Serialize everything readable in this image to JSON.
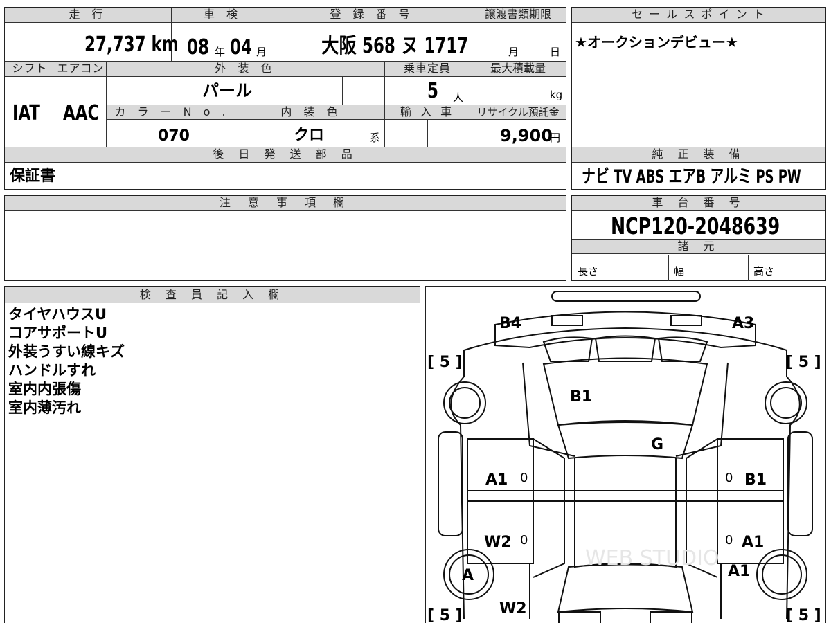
{
  "headers": {
    "mileage": "走 行",
    "inspection": "車 検",
    "registration": "登 録 番 号",
    "transfer_deadline": "譲渡書類期限",
    "sales_point": "セ ー ル ス ポ イ ン ト",
    "shift": "シフト",
    "aircon": "エアコン",
    "exterior_color": "外 装 色",
    "capacity": "乗車定員",
    "max_load": "最大積載量",
    "color_no": "カ ラ ー N o .",
    "interior_color": "内 装 色",
    "import": "輸 入 車",
    "recycle": "リサイクル預託金",
    "shipping_parts": "後 日 発 送 部 品",
    "equipment": "純 正 装 備",
    "notes": "注 意 事 項 欄",
    "chassis": "車 台 番 号",
    "specs": "諸 元",
    "inspector": "検 査 員 記 入 欄"
  },
  "values": {
    "mileage": "27,737 km",
    "inspection_year": "08",
    "inspection_year_unit": "年",
    "inspection_month": "04",
    "inspection_month_unit": "月",
    "registration": "大阪 568 ヌ 1717",
    "deadline_month": "月",
    "deadline_day": "日",
    "sales_point": "★オークションデビュー★",
    "shift": "IAT",
    "aircon": "AAC",
    "exterior_color": "パール",
    "capacity": "5",
    "capacity_unit": "人",
    "max_load_unit": "kg",
    "color_no": "070",
    "interior_color": "クロ",
    "interior_color_unit": "系",
    "recycle": "9,900",
    "recycle_unit": "円",
    "shipping_parts": "保証書",
    "equipment": "ナビ TV ABS エアB アルミ PS PW",
    "chassis": "NCP120-2048639",
    "length": "長さ",
    "width": "幅",
    "height": "高さ"
  },
  "inspector_notes": [
    "タイヤハウスU",
    "コアサポートU",
    "外装うすい線キズ",
    "ハンドルすれ",
    "室内内張傷",
    "室内薄汚れ"
  ],
  "diagram": {
    "b4": "B4",
    "a3": "A3",
    "b1_top": "B1",
    "g": "G",
    "a1_left": "A1",
    "b1_right": "B1",
    "w2_left": "W2",
    "a1_right": "A1",
    "a_left": "A",
    "a1_right_lower": "A1",
    "w2_bottom": "W2",
    "tire_tl": "[ 5 ]",
    "tire_tr": "[ 5 ]",
    "tire_bl": "[ 5 ]",
    "tire_br": "[ 5 ]",
    "zero": "0",
    "watermark": "WEB STUDIO"
  }
}
